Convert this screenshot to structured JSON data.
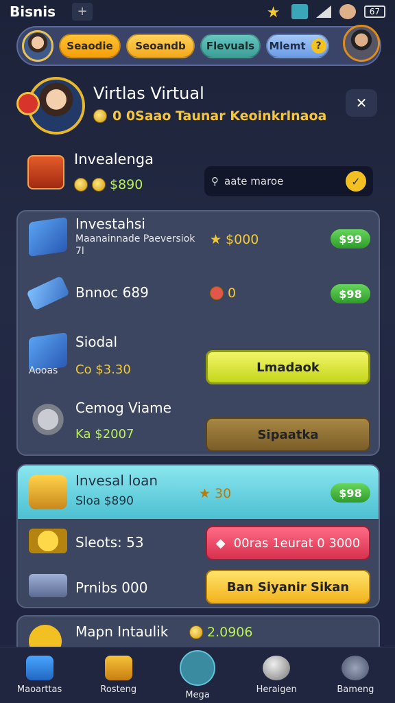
{
  "statusbar": {
    "app_name": "Bisnis",
    "plus": "+",
    "battery": "67"
  },
  "topnav": {
    "tabs": [
      "Seaodie",
      "Seoandb",
      "Flevuals",
      "Mlemt"
    ],
    "help": "?"
  },
  "profile": {
    "name": "Virtlas Virtual",
    "subtitle": "0 0Saao Taunar Keoinkrlnaoa",
    "share_icon": "share-icon"
  },
  "invest_row": {
    "title": "Invealenga",
    "amount": "$890",
    "search_placeholder": "aate maroe"
  },
  "panel1": {
    "rows": [
      {
        "title": "Investahsi",
        "sub": "Maanainnade Paeversiok",
        "sub2": "7l",
        "stat": "$000",
        "pill": "$99"
      },
      {
        "title": "Bnnoc 689",
        "stat": "0",
        "pill": "$98"
      },
      {
        "title": "Siodal",
        "sub": "Co $3.30",
        "label": "Aooas",
        "button": "Lmadaok"
      },
      {
        "title": "Cemog Viame",
        "sub": "Ka $2007",
        "button": "Sipaatka"
      }
    ]
  },
  "panel2": {
    "header": {
      "title": "Invesal loan",
      "sub": "Sloa $890",
      "stat": "30",
      "pill": "$98"
    },
    "rows": [
      {
        "title": "Sleots: 53",
        "button": "00ras 1eurat 0 3000"
      },
      {
        "title": "Prnibs 000",
        "button": "Ban Siyanir Sikan"
      }
    ]
  },
  "panel3": {
    "title": "Mapn Intaulik",
    "stat": "2.0906"
  },
  "bottomnav": [
    {
      "label": "Maoarttas",
      "icon": "home-icon"
    },
    {
      "label": "Rosteng",
      "icon": "building-icon"
    },
    {
      "label": "Mega",
      "icon": "profile-icon"
    },
    {
      "label": "Heraigen",
      "icon": "orb-icon"
    },
    {
      "label": "Bameng",
      "icon": "bag-icon"
    }
  ]
}
